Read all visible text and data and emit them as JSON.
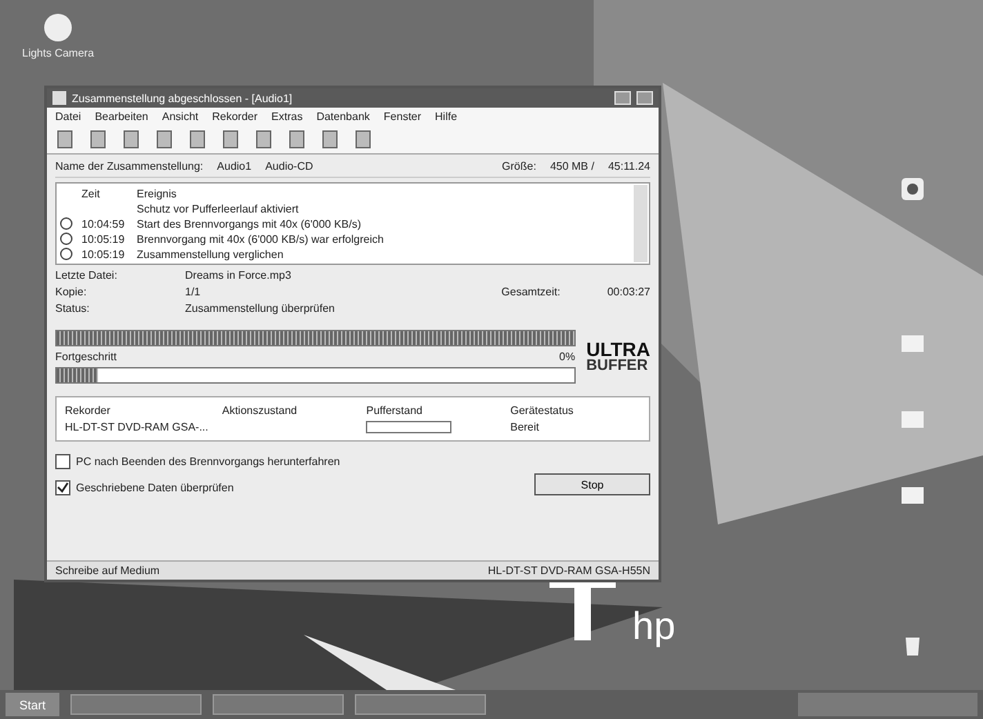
{
  "desktop": {
    "icons": [
      {
        "label": "Lights Camera"
      }
    ],
    "logo": "hp"
  },
  "window": {
    "title": "Zusammenstellung abgeschlossen - [Audio1]",
    "menu": [
      "Datei",
      "Bearbeiten",
      "Ansicht",
      "Rekorder",
      "Extras",
      "Datenbank",
      "Fenster",
      "Hilfe"
    ],
    "info": {
      "name_label": "Name der Zusammenstellung:",
      "name": "Audio1",
      "type": "Audio-CD",
      "size_label": "Größe:",
      "size": "450 MB /",
      "time": "45:11.24"
    },
    "log": {
      "columns": [
        "Zeit",
        "Ereignis"
      ],
      "rows": [
        {
          "time": "",
          "event": "Schutz vor Pufferleerlauf aktiviert",
          "icon": false
        },
        {
          "time": "10:04:59",
          "event": "Start des Brennvorgangs mit 40x (6'000 KB/s)",
          "icon": true
        },
        {
          "time": "10:05:19",
          "event": "Brennvorgang mit 40x (6'000 KB/s) war erfolgreich",
          "icon": true
        },
        {
          "time": "10:05:19",
          "event": "Zusammenstellung verglichen",
          "icon": true
        }
      ]
    },
    "details": [
      {
        "label": "Letzte Datei:",
        "value": "Dreams in Force.mp3"
      },
      {
        "label": "Kopie:",
        "value": "1/1",
        "extra_label": "Gesamtzeit:",
        "extra_value": "00:03:27"
      },
      {
        "label": "Status:",
        "value": "Zusammenstellung überprüfen"
      }
    ],
    "buffer_bar": {
      "level": 1
    },
    "progress": {
      "label": "Fortgeschritt",
      "percent": "0%",
      "level": 0.08
    },
    "logo": [
      "ULTRA",
      "BUFFER"
    ],
    "recorder": {
      "columns": [
        "Rekorder",
        "Aktionszustand",
        "Pufferstand",
        "Gerätestatus"
      ],
      "recorder": "HL-DT-ST DVD-RAM GSA-...",
      "buffer": {
        "level": 0
      },
      "status": "Bereit"
    },
    "options": [
      {
        "label": "PC nach Beenden des Brennvorgangs herunterfahren",
        "checked": false
      },
      {
        "label": "Geschriebene Daten überprüfen",
        "checked": true
      }
    ],
    "stop_button": "Stop",
    "status_bar": [
      "Schreibe auf Medium",
      "HL-DT-ST DVD-RAM GSA-H55N"
    ]
  },
  "taskbar": {
    "start": "Start"
  }
}
